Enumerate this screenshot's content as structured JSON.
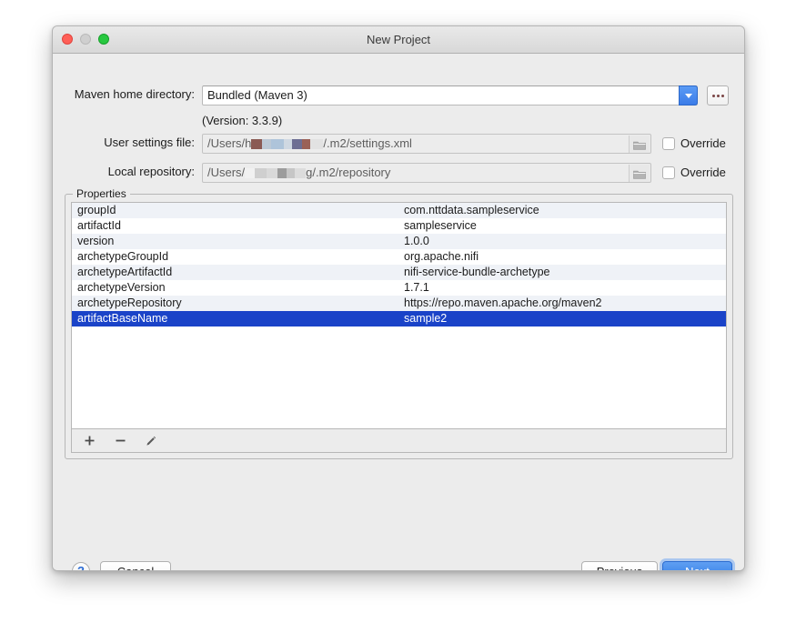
{
  "window": {
    "title": "New Project",
    "traffic_lights": [
      "close-button",
      "minimize-button",
      "zoom-button"
    ]
  },
  "form": {
    "maven_home": {
      "label": "Maven home directory:",
      "value": "Bundled (Maven 3)",
      "dropdown_icon": "chevron-down-icon",
      "browse_label": "...",
      "version_note": "(Version: 3.3.9)"
    },
    "user_settings": {
      "label": "User settings file:",
      "value_prefix": "/Users/h",
      "value_suffix": "/.m2/settings.xml",
      "folder_icon": "folder-icon",
      "override_label": "Override",
      "override_checked": false
    },
    "local_repository": {
      "label": "Local repository:",
      "value_prefix": "/Users/",
      "value_suffix": "g/.m2/repository",
      "folder_icon": "folder-icon",
      "override_label": "Override",
      "override_checked": false
    }
  },
  "properties": {
    "group_title": "Properties",
    "rows": [
      {
        "name": "groupId",
        "value": "com.nttdata.sampleservice"
      },
      {
        "name": "artifactId",
        "value": "sampleservice"
      },
      {
        "name": "version",
        "value": "1.0.0"
      },
      {
        "name": "archetypeGroupId",
        "value": "org.apache.nifi"
      },
      {
        "name": "archetypeArtifactId",
        "value": "nifi-service-bundle-archetype"
      },
      {
        "name": "archetypeVersion",
        "value": "1.7.1"
      },
      {
        "name": "archetypeRepository",
        "value": "https://repo.maven.apache.org/maven2"
      },
      {
        "name": "artifactBaseName",
        "value": "sample2"
      }
    ],
    "selected_index": 7,
    "toolbar": {
      "add_icon": "plus-icon",
      "remove_icon": "minus-icon",
      "edit_icon": "pencil-icon"
    }
  },
  "footer": {
    "help_label": "?",
    "cancel_label": "Cancel",
    "previous_label": "Previous",
    "next_label": "Next"
  },
  "colors": {
    "selection_blue": "#1a43c8",
    "primary_button_blue": "#2f7ae5",
    "window_bg": "#ececec",
    "row_stripe": "#eff2f7"
  }
}
